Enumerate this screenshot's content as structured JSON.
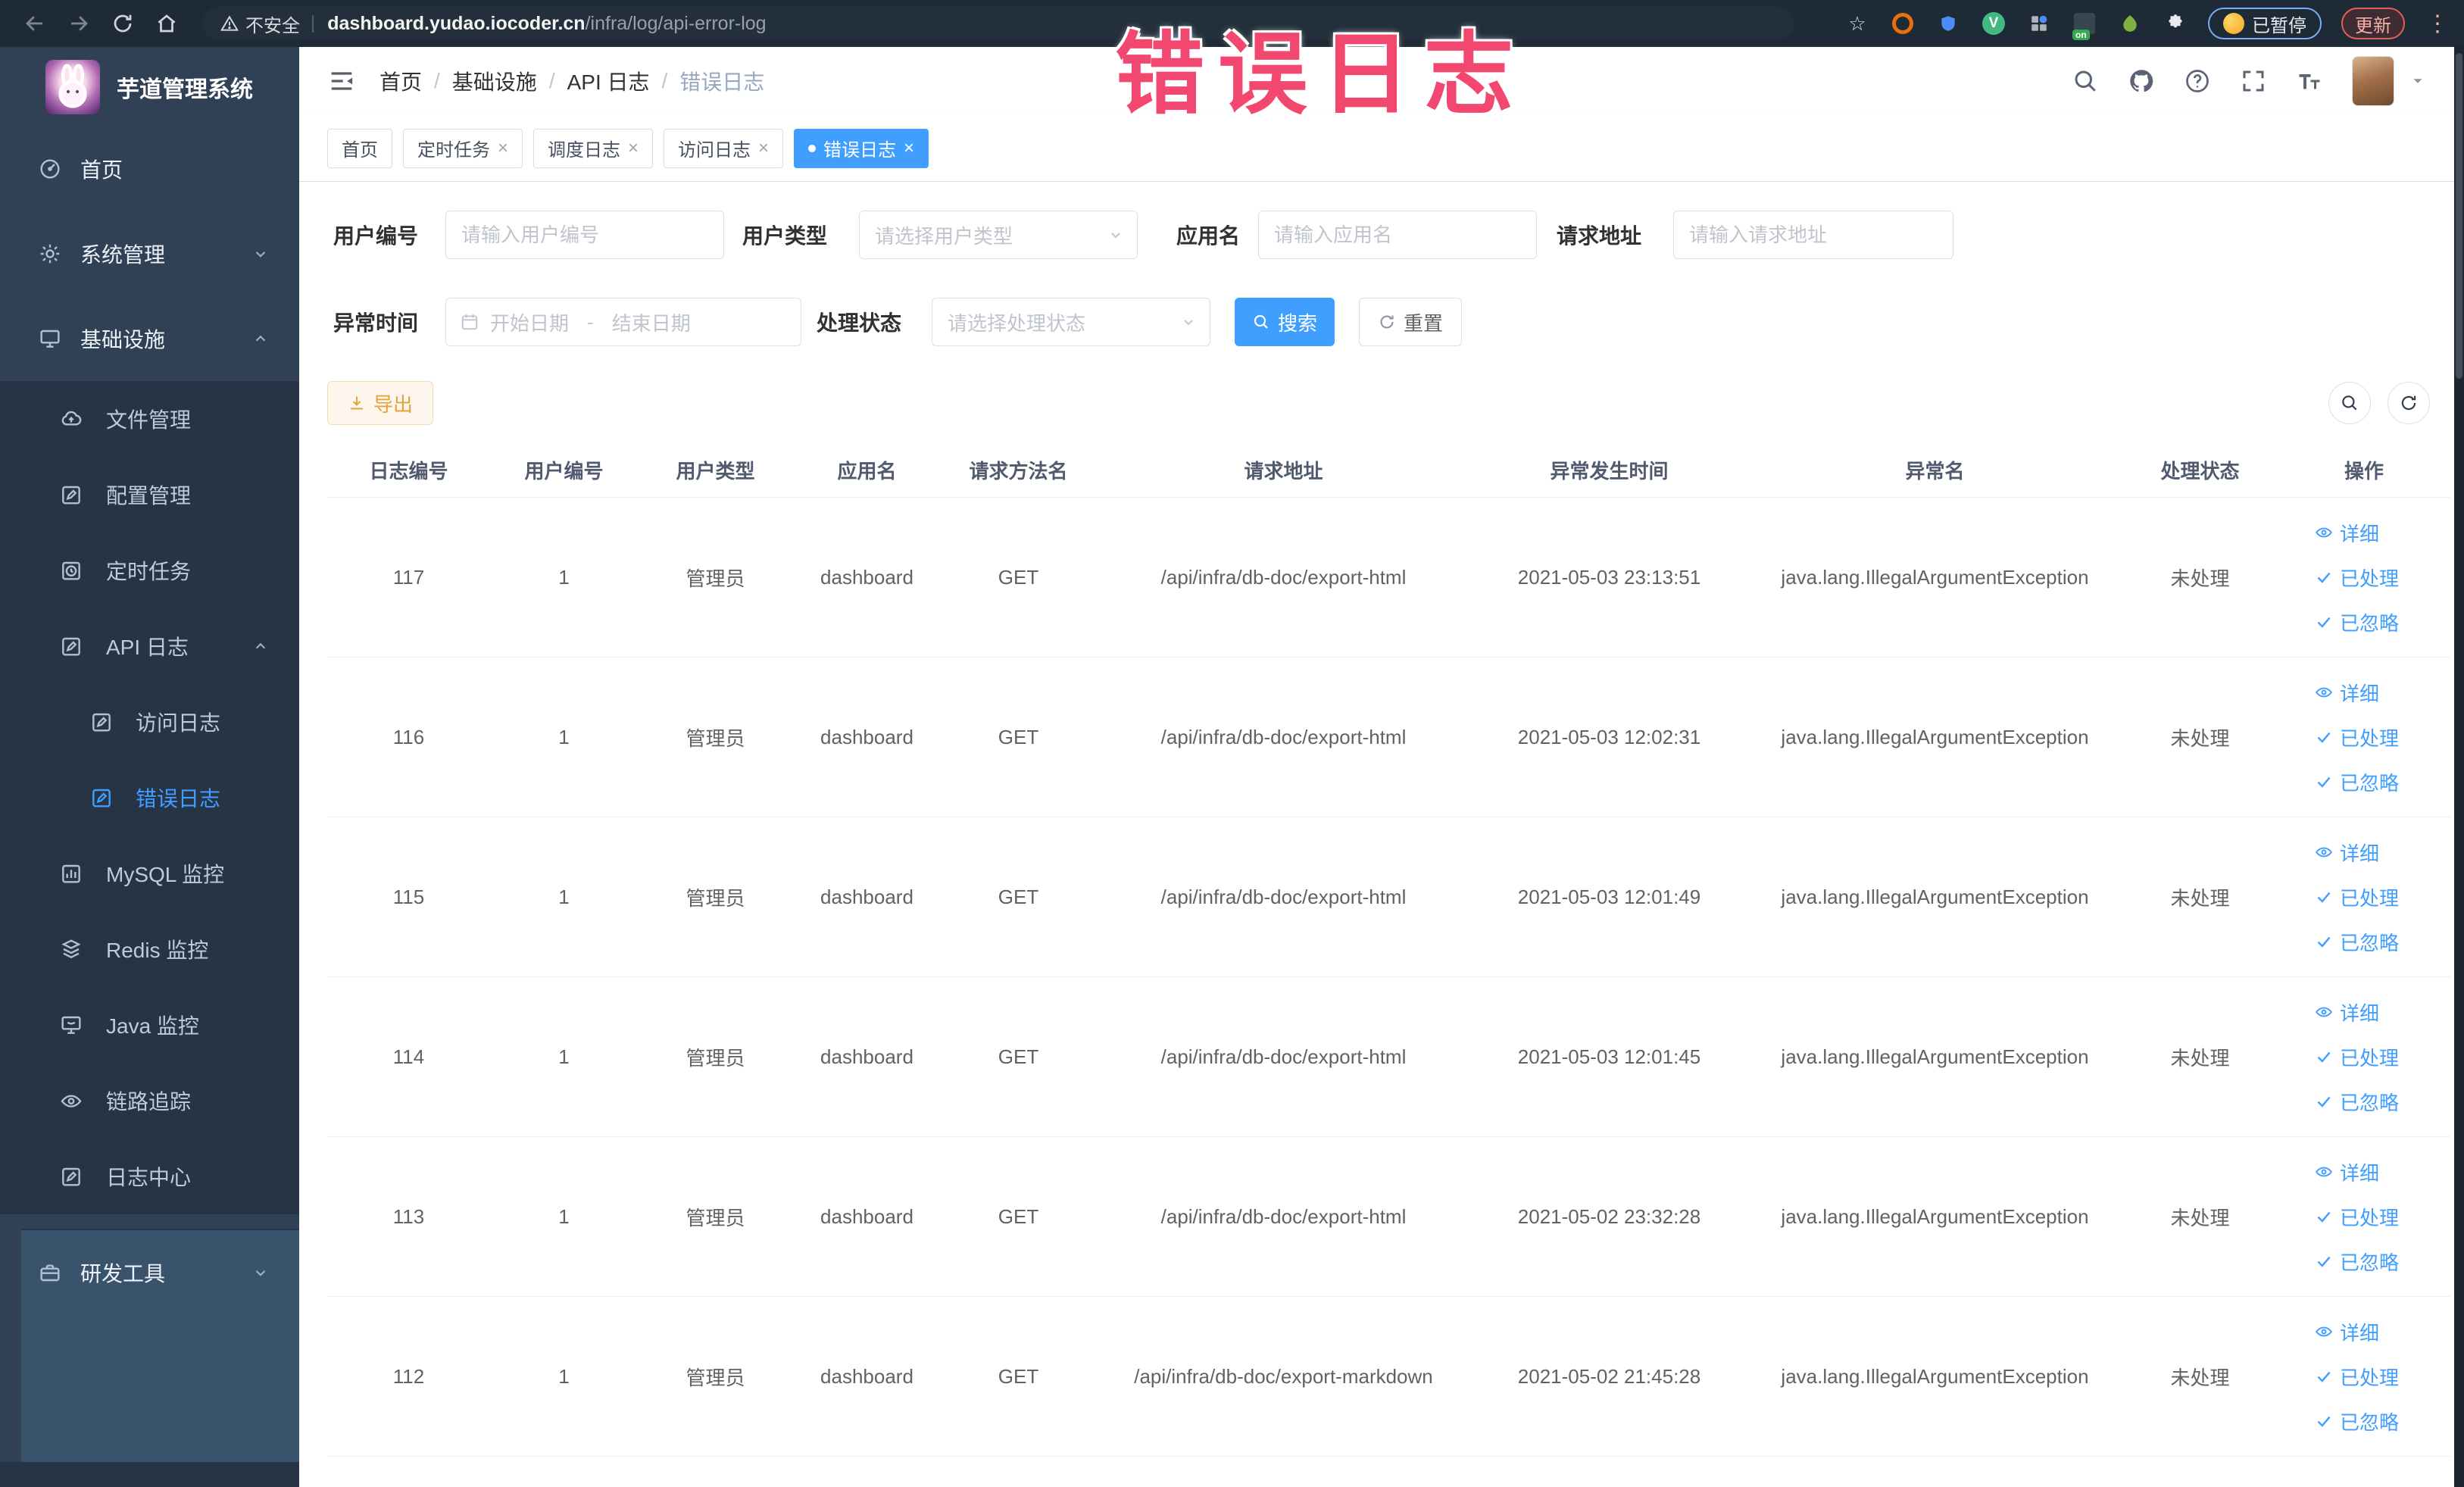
{
  "browser": {
    "security_label": "不安全",
    "url_host": "dashboard.yudao.iocoder.cn",
    "url_path": "/infra/log/api-error-log",
    "paused_badge": "已暂停",
    "update_button": "更新"
  },
  "annotation": {
    "text": "错误日志",
    "color": "#f2486f"
  },
  "icons": {
    "close": "×",
    "star": "☆",
    "kebab": "⋮",
    "divider": "|",
    "check": "✓",
    "eye_glyph": "◎"
  },
  "sidebar": {
    "app_title": "芋道管理系统",
    "items": [
      {
        "label": "首页",
        "icon": "gauge-icon",
        "level": 1
      },
      {
        "label": "系统管理",
        "icon": "gear-icon",
        "level": 1,
        "chevron": "down"
      },
      {
        "label": "基础设施",
        "icon": "monitor-icon",
        "level": 1,
        "chevron": "up",
        "expanded": true
      },
      {
        "label": "文件管理",
        "icon": "cloud-icon",
        "level": 2
      },
      {
        "label": "配置管理",
        "icon": "edit-icon",
        "level": 2
      },
      {
        "label": "定时任务",
        "icon": "timer-icon",
        "level": 2
      },
      {
        "label": "API 日志",
        "icon": "log-icon",
        "level": 2,
        "chevron": "up",
        "expanded": true
      },
      {
        "label": "访问日志",
        "icon": "log-icon",
        "level": 3
      },
      {
        "label": "错误日志",
        "icon": "log-icon",
        "level": 3,
        "active": true
      },
      {
        "label": "MySQL 监控",
        "icon": "chart-icon",
        "level": 2
      },
      {
        "label": "Redis 监控",
        "icon": "stack-icon",
        "level": 2
      },
      {
        "label": "Java 监控",
        "icon": "java-monitor-icon",
        "level": 2
      },
      {
        "label": "链路追踪",
        "icon": "eye-icon",
        "level": 2
      },
      {
        "label": "日志中心",
        "icon": "edit-icon",
        "level": 2
      },
      {
        "label": "研发工具",
        "icon": "briefcase-icon",
        "level": 1,
        "chevron": "down"
      }
    ]
  },
  "header": {
    "breadcrumb": [
      "首页",
      "基础设施",
      "API 日志",
      "错误日志"
    ]
  },
  "tabs": [
    {
      "label": "首页",
      "closable": false,
      "active": false
    },
    {
      "label": "定时任务",
      "closable": true,
      "active": false
    },
    {
      "label": "调度日志",
      "closable": true,
      "active": false
    },
    {
      "label": "访问日志",
      "closable": true,
      "active": false
    },
    {
      "label": "错误日志",
      "closable": true,
      "active": true
    }
  ],
  "filters": {
    "user_id": {
      "label": "用户编号",
      "placeholder": "请输入用户编号",
      "value": ""
    },
    "user_type": {
      "label": "用户类型",
      "placeholder": "请选择用户类型",
      "value": ""
    },
    "app_name": {
      "label": "应用名",
      "placeholder": "请输入应用名",
      "value": ""
    },
    "request_url": {
      "label": "请求地址",
      "placeholder": "请输入请求地址",
      "value": ""
    },
    "exception_time": {
      "label": "异常时间",
      "start_placeholder": "开始日期",
      "separator": "-",
      "end_placeholder": "结束日期"
    },
    "process_status": {
      "label": "处理状态",
      "placeholder": "请选择处理状态",
      "value": ""
    },
    "search_button": "搜索",
    "reset_button": "重置"
  },
  "toolbar": {
    "export_button": "导出"
  },
  "table": {
    "columns": [
      "日志编号",
      "用户编号",
      "用户类型",
      "应用名",
      "请求方法名",
      "请求地址",
      "异常发生时间",
      "异常名",
      "处理状态",
      "操作"
    ],
    "action_labels": {
      "detail": "详细",
      "processed": "已处理",
      "ignored": "已忽略"
    },
    "rows": [
      {
        "id": "117",
        "user_id": "1",
        "user_type": "管理员",
        "app": "dashboard",
        "method": "GET",
        "url": "/api/infra/db-doc/export-html",
        "time": "2021-05-03 23:13:51",
        "exception": "java.lang.IllegalArgumentException",
        "status": "未处理"
      },
      {
        "id": "116",
        "user_id": "1",
        "user_type": "管理员",
        "app": "dashboard",
        "method": "GET",
        "url": "/api/infra/db-doc/export-html",
        "time": "2021-05-03 12:02:31",
        "exception": "java.lang.IllegalArgumentException",
        "status": "未处理"
      },
      {
        "id": "115",
        "user_id": "1",
        "user_type": "管理员",
        "app": "dashboard",
        "method": "GET",
        "url": "/api/infra/db-doc/export-html",
        "time": "2021-05-03 12:01:49",
        "exception": "java.lang.IllegalArgumentException",
        "status": "未处理"
      },
      {
        "id": "114",
        "user_id": "1",
        "user_type": "管理员",
        "app": "dashboard",
        "method": "GET",
        "url": "/api/infra/db-doc/export-html",
        "time": "2021-05-03 12:01:45",
        "exception": "java.lang.IllegalArgumentException",
        "status": "未处理"
      },
      {
        "id": "113",
        "user_id": "1",
        "user_type": "管理员",
        "app": "dashboard",
        "method": "GET",
        "url": "/api/infra/db-doc/export-html",
        "time": "2021-05-02 23:32:28",
        "exception": "java.lang.IllegalArgumentException",
        "status": "未处理"
      },
      {
        "id": "112",
        "user_id": "1",
        "user_type": "管理员",
        "app": "dashboard",
        "method": "GET",
        "url": "/api/infra/db-doc/export-markdown",
        "time": "2021-05-02 21:45:28",
        "exception": "java.lang.IllegalArgumentException",
        "status": "未处理"
      }
    ]
  },
  "colors": {
    "primary": "#409eff",
    "warning": "#e6a23c",
    "sidebar_bg": "#304156",
    "submenu_bg": "#263445",
    "annotation": "#f2486f"
  }
}
